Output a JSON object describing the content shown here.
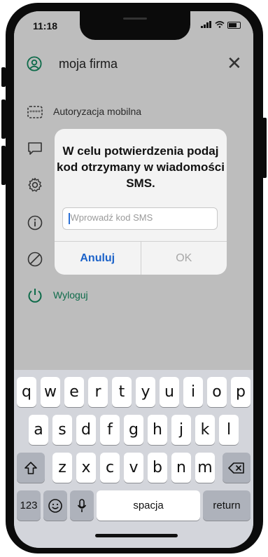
{
  "status_bar": {
    "time": "11:18",
    "signal": "..ıl",
    "wifi": "≈"
  },
  "header": {
    "title": "moja firma",
    "close_label": "✕"
  },
  "menu": {
    "items": [
      {
        "label": "Autoryzacja mobilna",
        "icon": "keypad-icon"
      },
      {
        "label": "",
        "icon": "message-icon"
      },
      {
        "label": "",
        "icon": "gear-icon"
      },
      {
        "label": "",
        "icon": "info-icon"
      },
      {
        "label": "",
        "icon": "block-icon"
      }
    ],
    "logout_label": "Wyloguj"
  },
  "dialog": {
    "line1": "W celu potwierdzenia podaj",
    "line2": "kod otrzymany w wiadomości",
    "line3": "SMS.",
    "input_placeholder": "Wprowadź kod SMS",
    "cancel_label": "Anuluj",
    "ok_label": "OK"
  },
  "keyboard": {
    "row1": [
      "q",
      "w",
      "e",
      "r",
      "t",
      "y",
      "u",
      "i",
      "o",
      "p"
    ],
    "row2": [
      "a",
      "s",
      "d",
      "f",
      "g",
      "h",
      "j",
      "k",
      "l"
    ],
    "row3": [
      "z",
      "x",
      "c",
      "v",
      "b",
      "n",
      "m"
    ],
    "numbers_label": "123",
    "space_label": "spacja",
    "return_label": "return"
  },
  "colors": {
    "accent_green": "#0e6b4a",
    "link_blue": "#1b62c9"
  }
}
